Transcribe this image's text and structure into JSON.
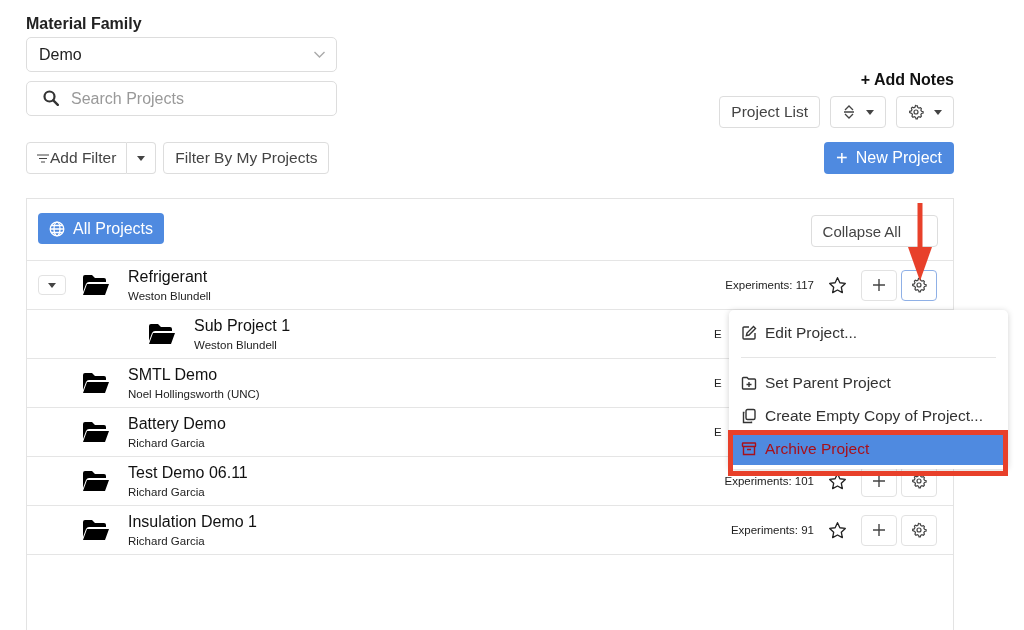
{
  "material_family": {
    "label": "Material Family",
    "value": "Demo"
  },
  "search": {
    "placeholder": "Search Projects"
  },
  "add_notes": {
    "icon": "+",
    "label": "Add Notes"
  },
  "toolbar": {
    "view_button": "Project List"
  },
  "filters": {
    "add_filter": "Add Filter",
    "my_projects": "Filter By My Projects"
  },
  "new_project": {
    "icon": "+",
    "label": "New Project"
  },
  "projects_header": {
    "all_projects": "All Projects",
    "collapse_all": "Collapse All"
  },
  "projects": [
    {
      "name": "Refrigerant",
      "owner": "Weston Blundell",
      "experiments": "Experiments: 117",
      "expanded": true,
      "actions": true,
      "gear_active": true,
      "children": [
        {
          "name": "Sub Project 1",
          "owner": "Weston Blundell",
          "experiments": "E",
          "actions": false
        }
      ]
    },
    {
      "name": "SMTL Demo",
      "owner": "Noel Hollingsworth (UNC)",
      "experiments": "E",
      "actions": false
    },
    {
      "name": "Battery Demo",
      "owner": "Richard Garcia",
      "experiments": "E",
      "actions": false
    },
    {
      "name": "Test Demo 06.11",
      "owner": "Richard Garcia",
      "experiments": "Experiments: 101",
      "actions": true,
      "gear_active": false
    },
    {
      "name": "Insulation Demo 1",
      "owner": "Richard Garcia",
      "experiments": "Experiments: 91",
      "actions": true,
      "gear_active": false
    }
  ],
  "context_menu": [
    {
      "kind": "edit",
      "label": "Edit Project...",
      "selected": false
    },
    {
      "kind": "divider"
    },
    {
      "kind": "parent",
      "label": "Set Parent Project",
      "selected": false
    },
    {
      "kind": "copy",
      "label": "Create Empty Copy of Project...",
      "selected": false
    },
    {
      "kind": "archive",
      "label": "Archive Project",
      "selected": true
    }
  ]
}
